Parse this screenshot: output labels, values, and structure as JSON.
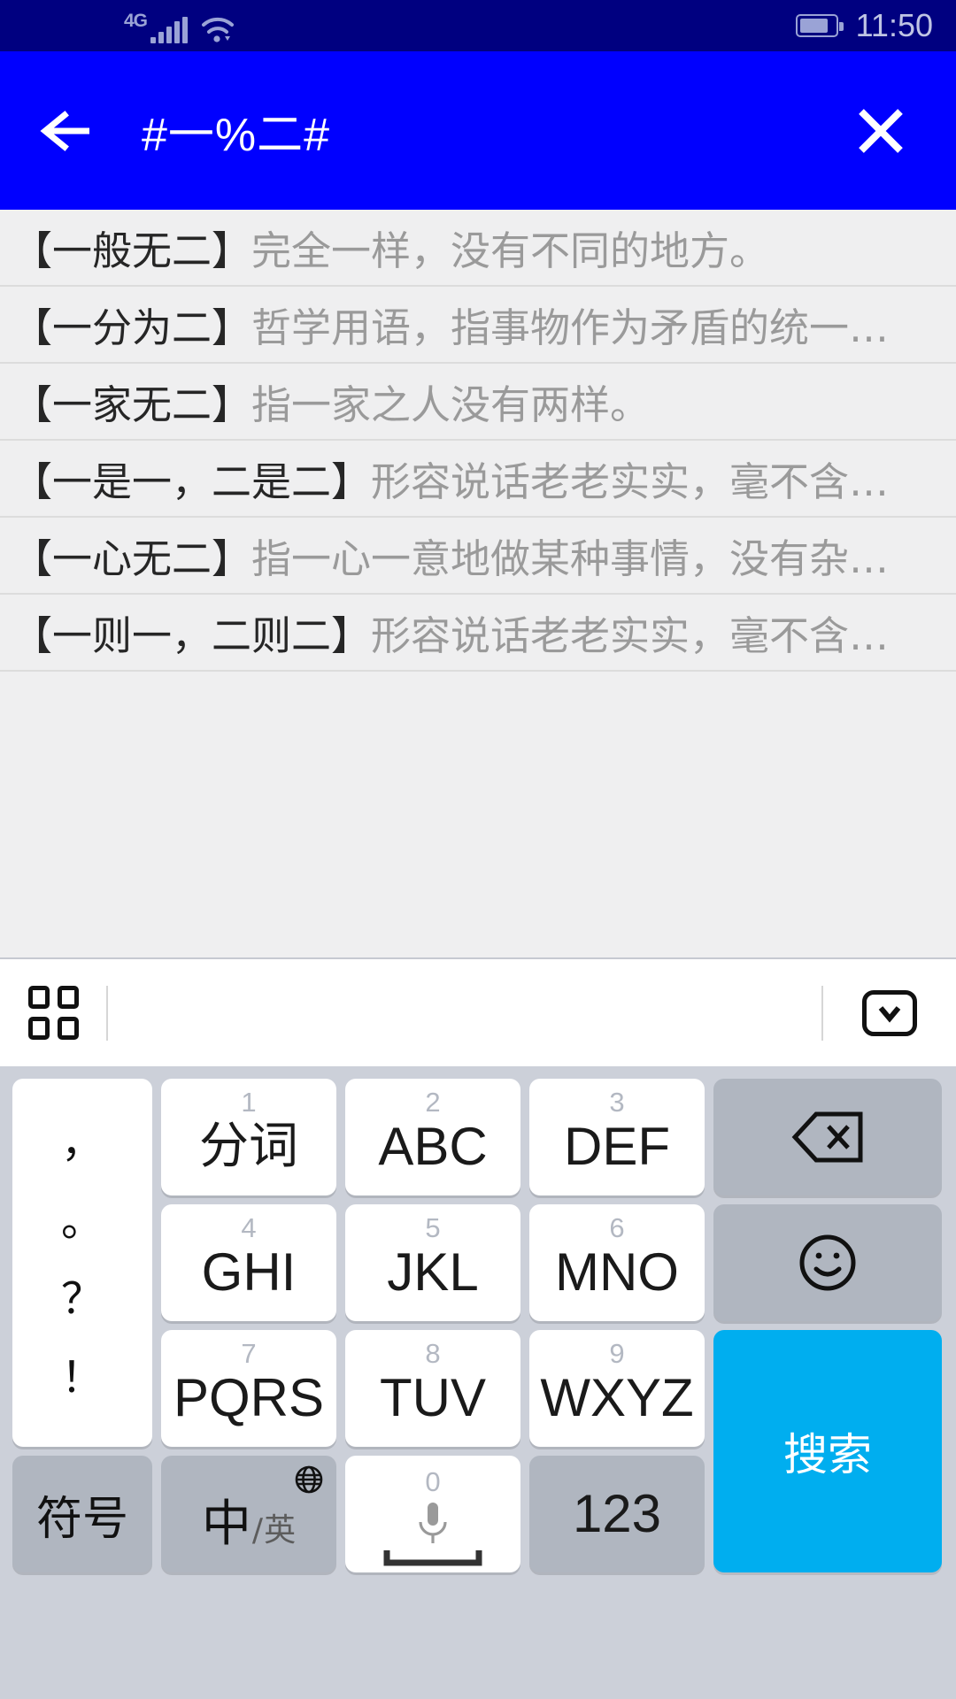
{
  "status_bar": {
    "network_label": "4G",
    "signal_icon": "signal-bars-icon",
    "wifi_icon": "wifi-icon",
    "battery_icon": "battery-icon",
    "time": "11:50"
  },
  "nav_bar": {
    "back_icon": "arrow-left-icon",
    "title": "#一%二#",
    "close_icon": "close-x-icon",
    "background_color": "#0000FF"
  },
  "results": [
    {
      "idiom": "【一般无二】",
      "definition": "完全一样，没有不同的地方。"
    },
    {
      "idiom": "【一分为二】",
      "definition": "哲学用语，指事物作为矛盾的统一…"
    },
    {
      "idiom": "【一家无二】",
      "definition": "指一家之人没有两样。"
    },
    {
      "idiom": "【一是一，二是二】",
      "definition": "形容说话老老实实，毫不含…"
    },
    {
      "idiom": "【一心无二】",
      "definition": "指一心一意地做某种事情，没有杂…"
    },
    {
      "idiom": "【一则一，二则二】",
      "definition": "形容说话老老实实，毫不含…"
    }
  ],
  "keyboard_toolbar": {
    "grid_icon": "grid-squares-icon",
    "hide_icon": "chevron-down-icon"
  },
  "keyboard": {
    "punctuation": [
      "，",
      "。",
      "？",
      "！"
    ],
    "keys": [
      {
        "num": "1",
        "label": "分词"
      },
      {
        "num": "2",
        "label": "ABC"
      },
      {
        "num": "3",
        "label": "DEF"
      },
      {
        "num": "4",
        "label": "GHI"
      },
      {
        "num": "5",
        "label": "JKL"
      },
      {
        "num": "6",
        "label": "MNO"
      },
      {
        "num": "7",
        "label": "PQRS"
      },
      {
        "num": "8",
        "label": "TUV"
      },
      {
        "num": "9",
        "label": "WXYZ"
      }
    ],
    "backspace_icon": "backspace-icon",
    "emoji_icon": "smiley-icon",
    "search_label": "搜索",
    "symbol_label": "符号",
    "lang_primary": "中",
    "lang_slash": "/",
    "lang_secondary": "英",
    "globe_icon": "globe-icon",
    "space_num": "0",
    "space_icon": "microphone-icon",
    "numeric_label": "123",
    "accent_color": "#00AEEF",
    "key_bg": "#FFFFFF",
    "fn_key_bg": "#B0B6C0",
    "keyboard_bg": "#CCD0D9"
  }
}
